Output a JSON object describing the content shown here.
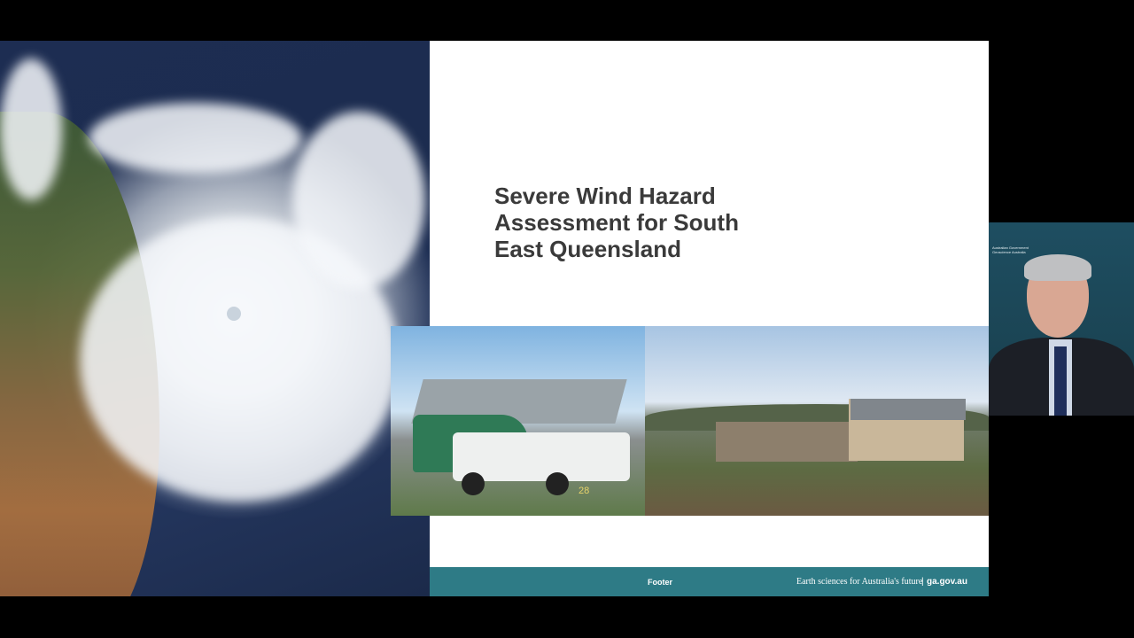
{
  "slide": {
    "title": "Severe Wind Hazard\nAssessment for South\nEast Queensland",
    "footer_label": "Footer",
    "footer_tagline": "Earth sciences for Australia's future",
    "footer_separator": "|",
    "footer_url": "ga.gov.au"
  },
  "photo1": {
    "date_stamp": "28"
  },
  "webcam": {
    "logo_text": "Australian Government\nGeoscience Australia"
  },
  "colors": {
    "footer_bar": "#2e7b86",
    "title_text": "#3a3a3a",
    "background": "#000000"
  }
}
